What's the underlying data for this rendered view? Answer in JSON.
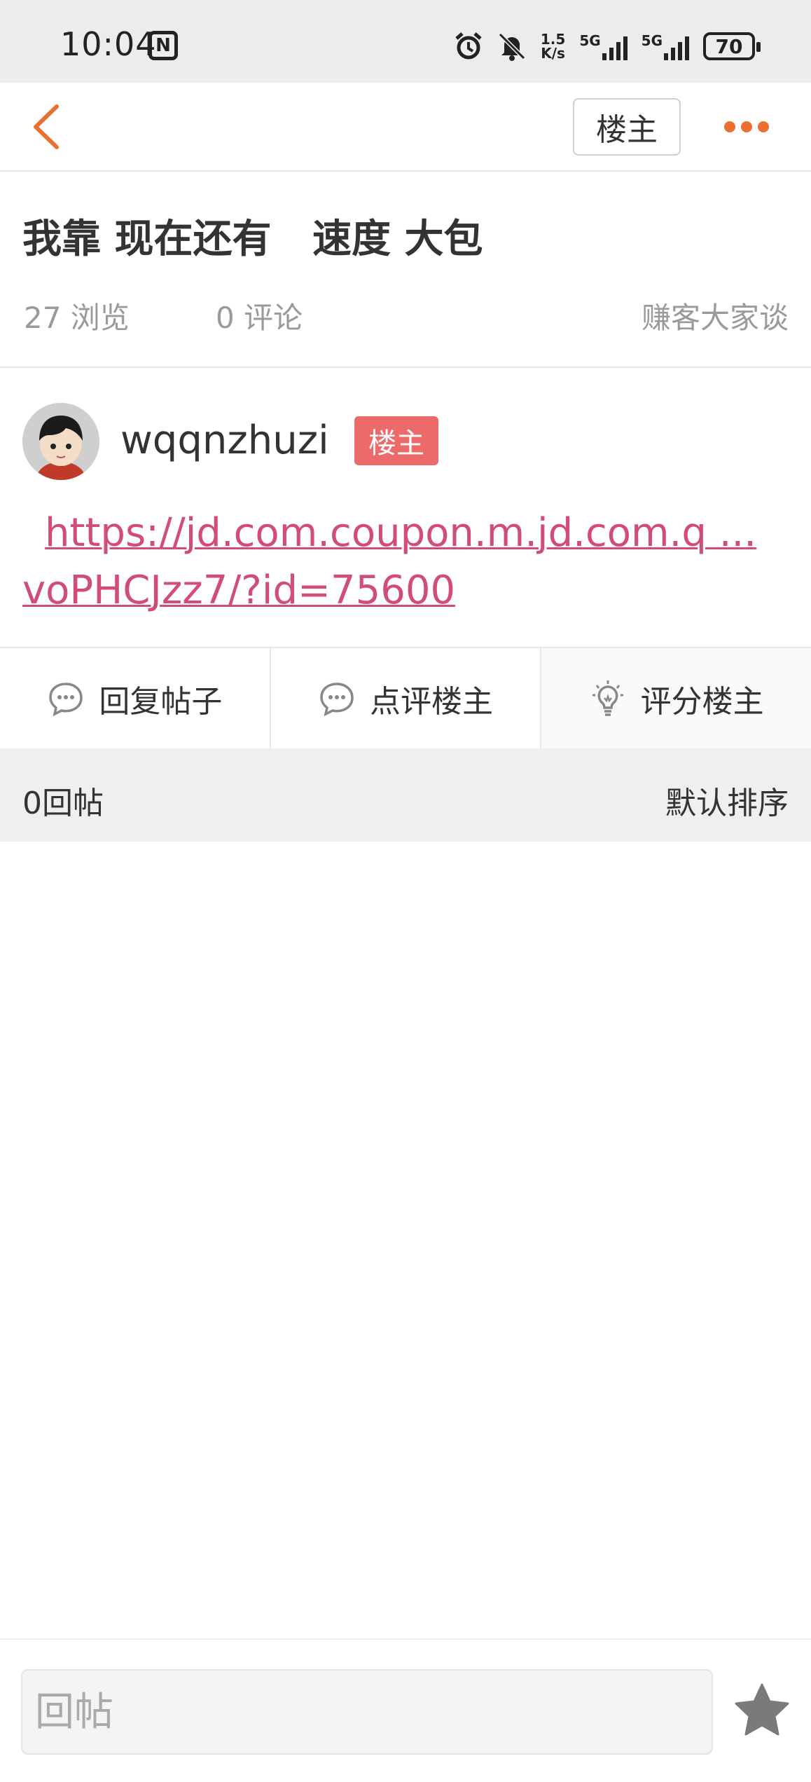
{
  "status_bar": {
    "time": "10:04",
    "nfc_label": "N",
    "speed_value": "1.5",
    "speed_unit": "K/s",
    "network1": "5G",
    "network2": "5G",
    "battery": "70"
  },
  "nav": {
    "owner_only_label": "楼主"
  },
  "post": {
    "title": "我靠 现在还有   速度 大包",
    "views": "27 浏览",
    "comments": "0 评论",
    "board": "赚客大家谈",
    "author": "wqqnzhuzi",
    "author_badge": "楼主",
    "link_line1": "https://jd.com.coupon.m.jd.com.q ...",
    "link_line2": "voPHCJzz7/?id=75600"
  },
  "actions": {
    "reply": "回复帖子",
    "comment_owner": "点评楼主",
    "rate_owner": "评分楼主"
  },
  "replies": {
    "count_label": "0回帖",
    "sort_label": "默认排序"
  },
  "bottom": {
    "reply_placeholder": "回帖"
  },
  "colors": {
    "accent": "#e9702f",
    "link": "#d14c7a",
    "badge": "#ec6a6a"
  }
}
